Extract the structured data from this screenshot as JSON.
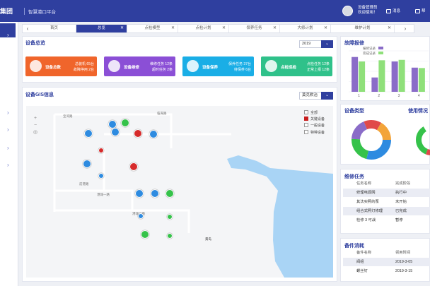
{
  "header": {
    "brand": "集团",
    "subtitle": "智慧港口平台",
    "user_role": "设备管理员",
    "welcome": "欢迎使用！",
    "messages_label": "消息",
    "help_label": "帮"
  },
  "tabs": {
    "items": [
      {
        "label": "首页",
        "closable": false,
        "active": false
      },
      {
        "label": "总览",
        "closable": true,
        "active": true
      },
      {
        "label": "点检模型",
        "closable": true,
        "active": false
      },
      {
        "label": "点检计划",
        "closable": true,
        "active": false
      },
      {
        "label": "保养任务",
        "closable": true,
        "active": false
      },
      {
        "label": "大修计划",
        "closable": true,
        "active": false
      },
      {
        "label": "维护计划",
        "closable": true,
        "active": false
      }
    ]
  },
  "overview": {
    "title": "设备总览",
    "year": "2019",
    "cards": [
      {
        "title": "设备总数",
        "line1": "总装机  65台",
        "line2": "故障停用  2台",
        "color": "#f0652b",
        "icon": "pie-chart-icon"
      },
      {
        "title": "设备维修",
        "line1": "维修任务  12条",
        "line2": "超时任务  2条",
        "color": "#8b4fd6",
        "icon": "gear-icon"
      },
      {
        "title": "设备保养",
        "line1": "保养任务  37台",
        "line2": "待保养  6台",
        "color": "#1aaee6",
        "icon": "wrench-icon"
      },
      {
        "title": "点检巡检",
        "line1": "点检任务  12条",
        "line2": "正常上报  12条",
        "color": "#2fc18a",
        "icon": "worker-icon"
      }
    ]
  },
  "gis": {
    "title": "设备GIS信息",
    "filter": "莫克默治",
    "legend": [
      "全部",
      "关键设备",
      "一般设备",
      "特种设备"
    ],
    "map_labels": [
      "宝湾路",
      "临海路",
      "前港路",
      "港城一路",
      "港城二路",
      "黄岛"
    ]
  },
  "fault": {
    "title": "故障报修",
    "legend": [
      "报修记录",
      "完成记录"
    ],
    "x_labels": [
      "1",
      "2",
      "3",
      "4"
    ]
  },
  "chart_data": {
    "type": "bar",
    "categories": [
      "1",
      "2",
      "3",
      "4"
    ],
    "series": [
      {
        "name": "报修记录",
        "values": [
          8.5,
          3.5,
          7.4,
          5.9
        ],
        "color": "#8a6cc8"
      },
      {
        "name": "完成记录",
        "values": [
          7.4,
          7.7,
          7.8,
          5.8
        ],
        "color": "#8fe07a"
      }
    ],
    "ylim": [
      0,
      10
    ]
  },
  "device_types": {
    "title": "设备类型"
  },
  "usage": {
    "title": "使用情况"
  },
  "maintenance": {
    "title": "维修任务",
    "columns": [
      "任务名称",
      "完成阶段"
    ],
    "rows": [
      [
        "修理电源网",
        "执行中"
      ],
      [
        "其法实照的泵",
        "未开始"
      ],
      [
        "组合式照灯修理",
        "已完成"
      ],
      [
        "检修 3 可战",
        "暂停"
      ]
    ]
  },
  "parts": {
    "title": "备件消耗",
    "columns": [
      "备件名称",
      "领用时间"
    ],
    "rows": [
      [
        "阀组",
        "2019-3-05"
      ],
      [
        "螺丝钉",
        "2019-3-15"
      ]
    ]
  }
}
